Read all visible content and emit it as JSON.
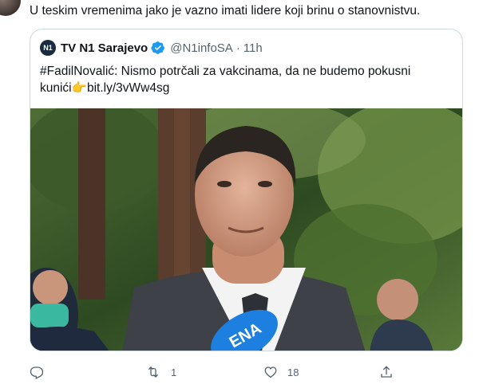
{
  "tweet": {
    "text": "U teskim vremenima jako je vazno imati lidere koji brinu o stanovnistvu."
  },
  "quote": {
    "avatar_text": "N1",
    "name": "TV N1 Sarajevo",
    "handle": "@N1infoSA",
    "separator": "·",
    "time": "11h",
    "text_line1": "#FadilNovalić: Nismo potrčali za vakcinama, da ne budemo pokusni",
    "text_line2_pre": "kunići",
    "text_emoji": "👉",
    "link": "bit.ly/3vWw4sg",
    "mic_text": "ENA"
  },
  "actions": {
    "reply_count": "",
    "retweet_count": "1",
    "like_count": "18"
  },
  "colors": {
    "verified": "#1d9bf0",
    "muted": "#536471",
    "border": "#cfd9de",
    "mic": "#1d7fe0"
  },
  "icons": [
    "reply-icon",
    "retweet-icon",
    "like-icon",
    "share-icon",
    "verified-badge-icon"
  ]
}
